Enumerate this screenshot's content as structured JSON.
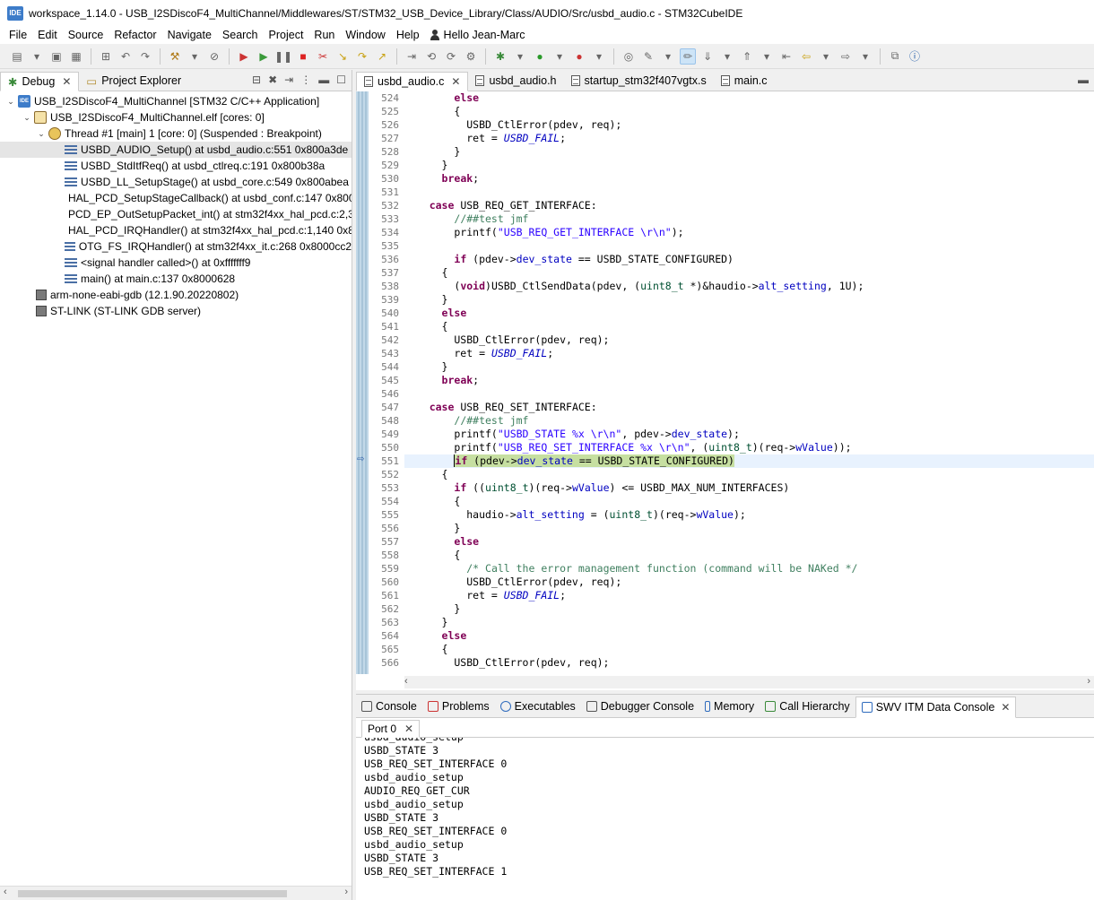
{
  "window": {
    "logo_text": "IDE",
    "title": "workspace_1.14.0 - USB_I2SDiscoF4_MultiChannel/Middlewares/ST/STM32_USB_Device_Library/Class/AUDIO/Src/usbd_audio.c - STM32CubeIDE"
  },
  "menu": [
    "File",
    "Edit",
    "Source",
    "Refactor",
    "Navigate",
    "Search",
    "Project",
    "Run",
    "Window",
    "Help"
  ],
  "user": "Hello Jean-Marc",
  "left_tabs": [
    {
      "label": "Debug",
      "icon": "debug-icon",
      "active": true
    },
    {
      "label": "Project Explorer",
      "icon": "folder-icon",
      "active": false
    }
  ],
  "debug_tree": [
    {
      "label": "USB_I2SDiscoF4_MultiChannel [STM32 C/C++ Application]",
      "level": 0,
      "twisty": "open",
      "icon": "app"
    },
    {
      "label": "USB_I2SDiscoF4_MultiChannel.elf [cores: 0]",
      "level": 1,
      "twisty": "open",
      "icon": "elf"
    },
    {
      "label": "Thread #1 [main] 1 [core: 0] (Suspended : Breakpoint)",
      "level": 2,
      "twisty": "open",
      "icon": "thread"
    },
    {
      "label": "USBD_AUDIO_Setup() at usbd_audio.c:551 0x800a3de",
      "level": 3,
      "icon": "frame",
      "selected": true
    },
    {
      "label": "USBD_StdItfReq() at usbd_ctlreq.c:191 0x800b38a",
      "level": 3,
      "icon": "frame"
    },
    {
      "label": "USBD_LL_SetupStage() at usbd_core.c:549 0x800abea",
      "level": 3,
      "icon": "frame"
    },
    {
      "label": "HAL_PCD_SetupStageCallback() at usbd_conf.c:147 0x800",
      "level": 3,
      "icon": "frame"
    },
    {
      "label": "PCD_EP_OutSetupPacket_int() at stm32f4xx_hal_pcd.c:2,3",
      "level": 3,
      "icon": "frame"
    },
    {
      "label": "HAL_PCD_IRQHandler() at stm32f4xx_hal_pcd.c:1,140 0x8",
      "level": 3,
      "icon": "frame"
    },
    {
      "label": "OTG_FS_IRQHandler() at stm32f4xx_it.c:268 0x8000cc2",
      "level": 3,
      "icon": "frame"
    },
    {
      "label": "<signal handler called>() at 0xfffffff9",
      "level": 3,
      "icon": "frame"
    },
    {
      "label": "main() at main.c:137 0x8000628",
      "level": 3,
      "icon": "frame"
    },
    {
      "label": "arm-none-eabi-gdb (12.1.90.20220802)",
      "level": 1,
      "icon": "gdb"
    },
    {
      "label": "ST-LINK (ST-LINK GDB server)",
      "level": 1,
      "icon": "gdb"
    }
  ],
  "editor_tabs": [
    {
      "label": "usbd_audio.c",
      "active": true
    },
    {
      "label": "usbd_audio.h",
      "active": false
    },
    {
      "label": "startup_stm32f407vgtx.s",
      "active": false
    },
    {
      "label": "main.c",
      "active": false
    }
  ],
  "code": {
    "current_line": 551,
    "lines": [
      {
        "n": "524",
        "t": "        else"
      },
      {
        "n": "525",
        "t": "        {"
      },
      {
        "n": "526",
        "t": "          USBD_CtlError(pdev, req);"
      },
      {
        "n": "527",
        "t": "          ret = USBD_FAIL;"
      },
      {
        "n": "528",
        "t": "        }"
      },
      {
        "n": "529",
        "t": "      }"
      },
      {
        "n": "530",
        "t": "      break;"
      },
      {
        "n": "531",
        "t": ""
      },
      {
        "n": "532",
        "t": "    case USB_REQ_GET_INTERFACE:"
      },
      {
        "n": "533",
        "t": "        //##test jmf"
      },
      {
        "n": "534",
        "t": "        printf(\"USB_REQ_GET_INTERFACE \\r\\n\");"
      },
      {
        "n": "535",
        "t": ""
      },
      {
        "n": "536",
        "t": "        if (pdev->dev_state == USBD_STATE_CONFIGURED)"
      },
      {
        "n": "537",
        "t": "      {"
      },
      {
        "n": "538",
        "t": "        (void)USBD_CtlSendData(pdev, (uint8_t *)&haudio->alt_setting, 1U);"
      },
      {
        "n": "539",
        "t": "      }"
      },
      {
        "n": "540",
        "t": "      else"
      },
      {
        "n": "541",
        "t": "      {"
      },
      {
        "n": "542",
        "t": "        USBD_CtlError(pdev, req);"
      },
      {
        "n": "543",
        "t": "        ret = USBD_FAIL;"
      },
      {
        "n": "544",
        "t": "      }"
      },
      {
        "n": "545",
        "t": "      break;"
      },
      {
        "n": "546",
        "t": ""
      },
      {
        "n": "547",
        "t": "    case USB_REQ_SET_INTERFACE:"
      },
      {
        "n": "548",
        "t": "        //##test jmf"
      },
      {
        "n": "549",
        "t": "        printf(\"USBD_STATE %x \\r\\n\", pdev->dev_state);"
      },
      {
        "n": "550",
        "t": "        printf(\"USB_REQ_SET_INTERFACE %x \\r\\n\", (uint8_t)(req->wValue));"
      },
      {
        "n": "551",
        "t": "        if (pdev->dev_state == USBD_STATE_CONFIGURED)"
      },
      {
        "n": "552",
        "t": "      {"
      },
      {
        "n": "553",
        "t": "        if ((uint8_t)(req->wValue) <= USBD_MAX_NUM_INTERFACES)"
      },
      {
        "n": "554",
        "t": "        {"
      },
      {
        "n": "555",
        "t": "          haudio->alt_setting = (uint8_t)(req->wValue);"
      },
      {
        "n": "556",
        "t": "        }"
      },
      {
        "n": "557",
        "t": "        else"
      },
      {
        "n": "558",
        "t": "        {"
      },
      {
        "n": "559",
        "t": "          /* Call the error management function (command will be NAKed */"
      },
      {
        "n": "560",
        "t": "          USBD_CtlError(pdev, req);"
      },
      {
        "n": "561",
        "t": "          ret = USBD_FAIL;"
      },
      {
        "n": "562",
        "t": "        }"
      },
      {
        "n": "563",
        "t": "      }"
      },
      {
        "n": "564",
        "t": "      else"
      },
      {
        "n": "565",
        "t": "      {"
      },
      {
        "n": "566",
        "t": "        USBD_CtlError(pdev, req);"
      }
    ]
  },
  "console_tabs": [
    {
      "label": "Console",
      "active": false
    },
    {
      "label": "Problems",
      "active": false
    },
    {
      "label": "Executables",
      "active": false
    },
    {
      "label": "Debugger Console",
      "active": false
    },
    {
      "label": "Memory",
      "active": false
    },
    {
      "label": "Call Hierarchy",
      "active": false
    },
    {
      "label": "SWV ITM Data Console",
      "active": true
    }
  ],
  "port_tab": "Port 0",
  "console_output": [
    "usbd_audio_setup",
    "USBD_STATE 3",
    "USB_REQ_SET_INTERFACE 0",
    "usbd_audio_setup",
    "AUDIO_REQ_GET_CUR",
    "usbd_audio_setup",
    "USBD_STATE 3",
    "USB_REQ_SET_INTERFACE 0",
    "usbd_audio_setup",
    "USBD_STATE 3",
    "USB_REQ_SET_INTERFACE 1"
  ],
  "colors": {
    "current_line_highlight": "#c6dfa1",
    "keyword": "#7f0055",
    "string": "#2a00ff",
    "comment": "#3f7f5f",
    "field": "#0000c0"
  }
}
